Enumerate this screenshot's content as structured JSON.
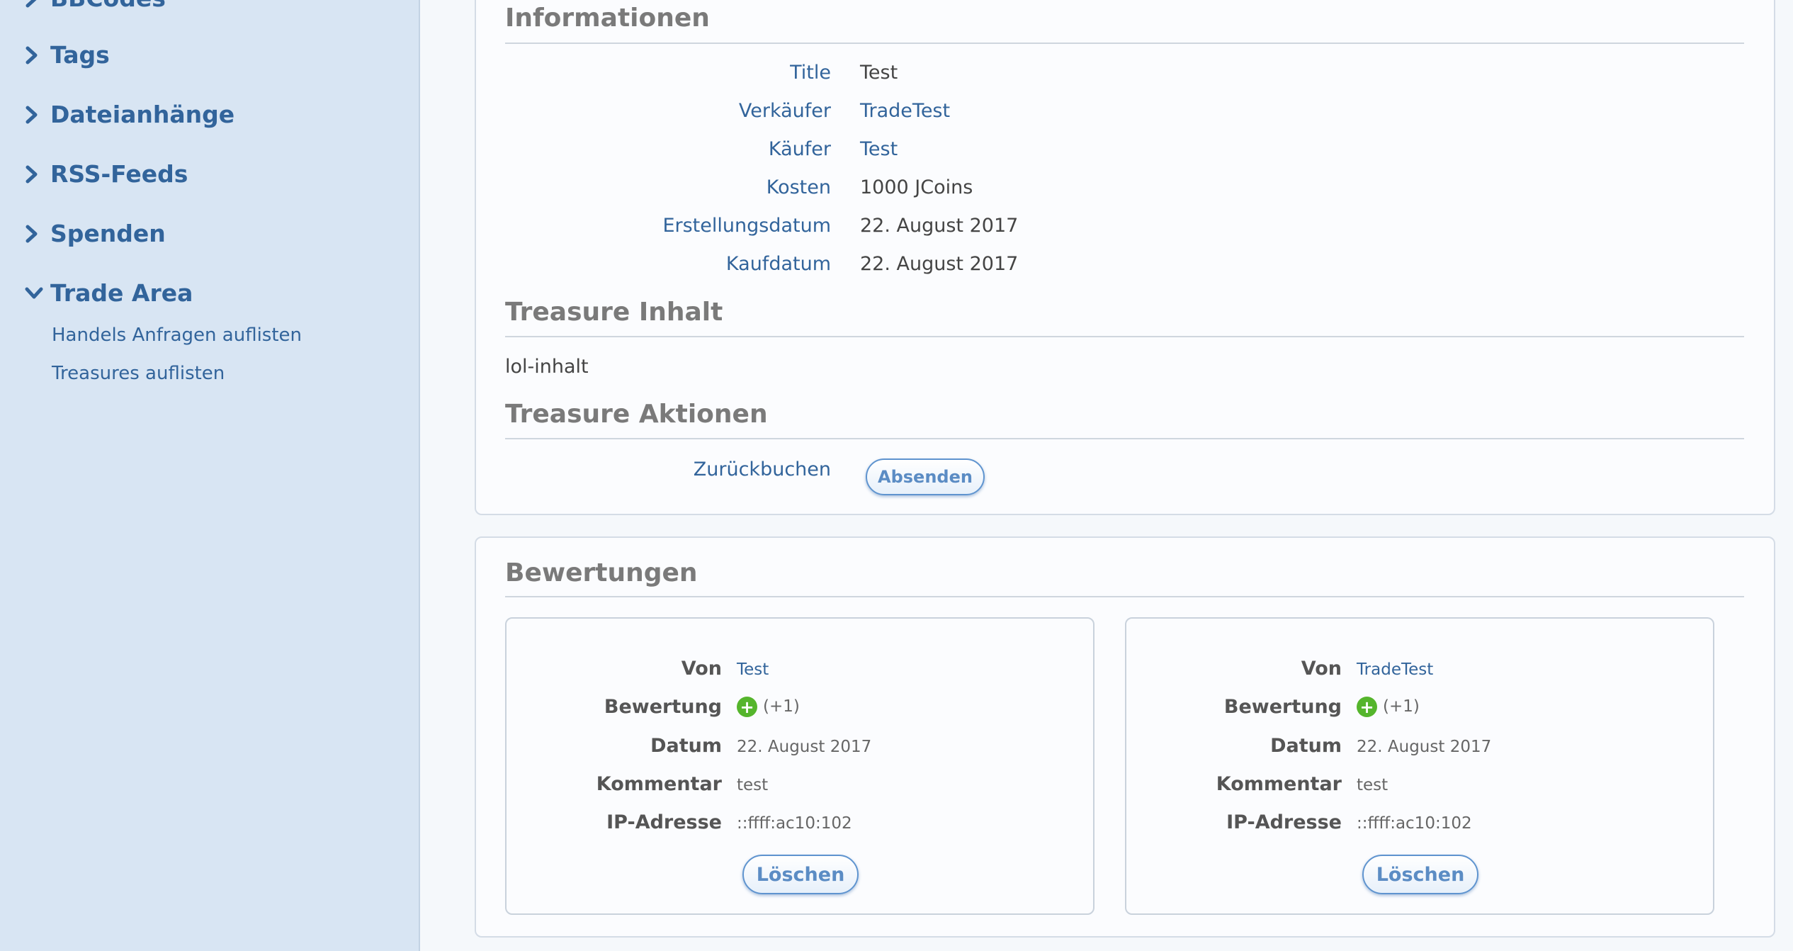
{
  "sidebar": {
    "items": [
      {
        "label": "BBCodes",
        "expanded": false
      },
      {
        "label": "Tags",
        "expanded": false
      },
      {
        "label": "Dateianhänge",
        "expanded": false
      },
      {
        "label": "RSS-Feeds",
        "expanded": false
      },
      {
        "label": "Spenden",
        "expanded": false
      },
      {
        "label": "Trade Area",
        "expanded": true
      }
    ],
    "subitems": [
      {
        "label": "Handels Anfragen auflisten"
      },
      {
        "label": "Treasures auflisten"
      }
    ]
  },
  "informationen": {
    "title": "Informationen",
    "rows": [
      {
        "label": "Title",
        "value": "Test"
      },
      {
        "label": "Verkäufer",
        "value": "TradeTest"
      },
      {
        "label": "Käufer",
        "value": "Test"
      },
      {
        "label": "Kosten",
        "value": "1000 JCoins"
      },
      {
        "label": "Erstellungsdatum",
        "value": "22. August 2017"
      },
      {
        "label": "Kaufdatum",
        "value": "22. August 2017"
      }
    ]
  },
  "treasure_inhalt": {
    "title": "Treasure Inhalt",
    "content": "lol-inhalt"
  },
  "treasure_aktionen": {
    "title": "Treasure Aktionen",
    "label": "Zurückbuchen",
    "button": "Absenden"
  },
  "bewertungen": {
    "title": "Bewertungen",
    "labels": {
      "von": "Von",
      "bewertung": "Bewertung",
      "datum": "Datum",
      "kommentar": "Kommentar",
      "ip": "IP-Adresse"
    },
    "cards": [
      {
        "von": "Test",
        "bewertung": "(+1)",
        "datum": "22. August 2017",
        "kommentar": "test",
        "ip": "::ffff:ac10:102",
        "button": "Löschen"
      },
      {
        "von": "TradeTest",
        "bewertung": "(+1)",
        "datum": "22. August 2017",
        "kommentar": "test",
        "ip": "::ffff:ac10:102",
        "button": "Löschen"
      }
    ]
  },
  "colors": {
    "link": "#32649b",
    "sidebar_bg": "#d8e5f3",
    "positive": "#55b52c"
  },
  "icons": {
    "collapsed": "chevron-right-icon",
    "expanded": "chevron-down-icon",
    "positive_rating": "plus-circle-icon"
  }
}
